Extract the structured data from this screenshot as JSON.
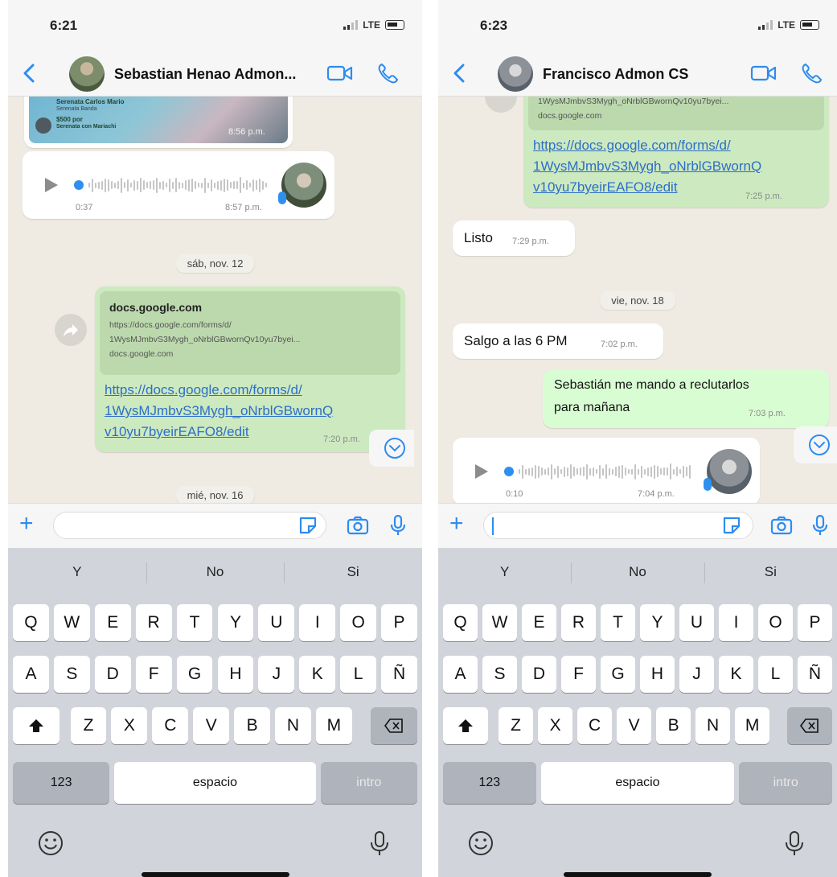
{
  "screen1": {
    "status": {
      "time": "6:21",
      "network": "LTE"
    },
    "header": {
      "contact": "Sebastian Henao Admon..."
    },
    "messages": {
      "image_time": "8:56 p.m.",
      "image_caption_lines": [
        "Serenata Carlos Mario",
        "Serenata Banda",
        "$500 por",
        "Serenata con Mariachi"
      ],
      "voice_duration": "0:37",
      "voice_time": "8:57 p.m.",
      "date1": "sáb, nov. 12",
      "preview_title": "docs.google.com",
      "preview_line1": "https://docs.google.com/forms/d/",
      "preview_line2": "1WysMJmbvS3Mygh_oNrblGBwornQv10yu7byei...",
      "preview_line3": "docs.google.com",
      "link_lines": [
        "https://docs.google.com/forms/d/",
        "1WysMJmbvS3Mygh_oNrblGBwornQ",
        "v10yu7byeirEAFO8/edit"
      ],
      "link_time": "7:20 p.m.",
      "date2": "mié, nov. 16"
    }
  },
  "screen2": {
    "status": {
      "time": "6:23",
      "network": "LTE"
    },
    "header": {
      "contact": "Francisco Admon CS"
    },
    "messages": {
      "preview_line2": "1WysMJmbvS3Mygh_oNrblGBwornQv10yu7byei...",
      "preview_line3": "docs.google.com",
      "link_lines": [
        "https://docs.google.com/forms/d/",
        "1WysMJmbvS3Mygh_oNrblGBwornQ",
        "v10yu7byeirEAFO8/edit"
      ],
      "link_time": "7:25 p.m.",
      "listo_text": "Listo",
      "listo_time": "7:29 p.m.",
      "date1": "vie, nov. 18",
      "salgo_text": "Salgo a las 6 PM",
      "salgo_time": "7:02 p.m.",
      "out_text_line1": "Sebastián me mando a reclutarlos",
      "out_text_line2": "para mañana",
      "out_time": "7:03 p.m.",
      "voice_duration": "0:10",
      "voice_time": "7:04 p.m."
    }
  },
  "keyboard": {
    "suggestions": [
      "Y",
      "No",
      "Si"
    ],
    "row1": [
      "Q",
      "W",
      "E",
      "R",
      "T",
      "Y",
      "U",
      "I",
      "O",
      "P"
    ],
    "row2": [
      "A",
      "S",
      "D",
      "F",
      "G",
      "H",
      "J",
      "K",
      "L",
      "Ñ"
    ],
    "row3": [
      "Z",
      "X",
      "C",
      "V",
      "B",
      "N",
      "M"
    ],
    "numbers_key": "123",
    "space_key": "espacio",
    "return_key": "intro"
  },
  "icons": [
    "back-chevron-icon",
    "video-call-icon",
    "phone-call-icon",
    "plus-icon",
    "sticker-icon",
    "camera-icon",
    "microphone-icon",
    "shift-icon",
    "backspace-icon",
    "emoji-icon",
    "dictation-icon",
    "forward-icon",
    "scroll-down-icon",
    "play-icon"
  ],
  "colors": {
    "accent": "#2d8cf0",
    "chat_bg": "#efeae2",
    "outgoing": "#d9fdd3",
    "link": "#2d6fc7"
  }
}
